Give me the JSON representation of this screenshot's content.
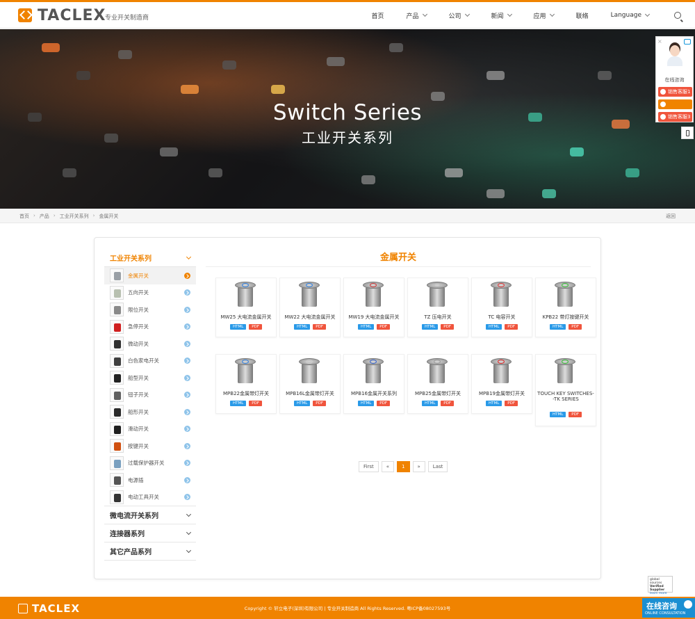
{
  "header": {
    "logo_text": "TACLEX",
    "tagline": "专业开关制造商",
    "nav": [
      {
        "label": "首页",
        "has_menu": false
      },
      {
        "label": "产品",
        "has_menu": true
      },
      {
        "label": "公司",
        "has_menu": true
      },
      {
        "label": "新闻",
        "has_menu": true
      },
      {
        "label": "应用",
        "has_menu": true
      },
      {
        "label": "联络",
        "has_menu": false
      },
      {
        "label": "Language",
        "has_menu": true
      }
    ]
  },
  "banner": {
    "title": "Switch Series",
    "subtitle": "工业开关系列"
  },
  "chat_widget": {
    "label": "在线咨询",
    "buttons": [
      {
        "label": "销售客服1",
        "color": "#f0543c"
      },
      {
        "label": "",
        "color": "#f08300"
      },
      {
        "label": "销售客服3",
        "color": "#f0543c"
      }
    ]
  },
  "breadcrumb": {
    "items": [
      "首页",
      "产品",
      "工业开关系列",
      "金属开关"
    ],
    "sep": "›",
    "back": "返回"
  },
  "sidebar": {
    "active_category": "工业开关系列",
    "items": [
      {
        "label": "金属开关",
        "selected": true,
        "color": "#9aa0a6"
      },
      {
        "label": "五向开关",
        "selected": false,
        "color": "#b8c0b0"
      },
      {
        "label": "限位开关",
        "selected": false,
        "color": "#8a8a8a"
      },
      {
        "label": "急停开关",
        "selected": false,
        "color": "#d02020"
      },
      {
        "label": "微动开关",
        "selected": false,
        "color": "#303030"
      },
      {
        "label": "白色家电开关",
        "selected": false,
        "color": "#404040"
      },
      {
        "label": "船型开关",
        "selected": false,
        "color": "#222222"
      },
      {
        "label": "钮子开关",
        "selected": false,
        "color": "#606060"
      },
      {
        "label": "船形开关",
        "selected": false,
        "color": "#2a2a2a"
      },
      {
        "label": "滑动开关",
        "selected": false,
        "color": "#1f1f1f"
      },
      {
        "label": "按键开关",
        "selected": false,
        "color": "#d05010"
      },
      {
        "label": "过载保护器开关",
        "selected": false,
        "color": "#7aa0c0"
      },
      {
        "label": "电源插",
        "selected": false,
        "color": "#555555"
      },
      {
        "label": "电动工具开关",
        "selected": false,
        "color": "#333333"
      }
    ],
    "other_categories": [
      "微电流开关系列",
      "连接器系列",
      "其它产品系列"
    ]
  },
  "content": {
    "title": "金属开关",
    "tag_html": "HTML",
    "tag_pdf": "PDF",
    "products": [
      {
        "name": "MW25 大电流金属开关",
        "ring": "#2a7de1"
      },
      {
        "name": "MW22 大电流金属开关",
        "ring": "#2a7de1"
      },
      {
        "name": "MW19 大电流金属开关",
        "ring": "#d03030"
      },
      {
        "name": "TZ 压电开关",
        "ring": "#bbbbbb"
      },
      {
        "name": "TC 电容开关",
        "ring": "#e03030"
      },
      {
        "name": "KPB22 带灯按键开关",
        "ring": "#30c030"
      },
      {
        "name": "MPB22金属带灯开关",
        "ring": "#2a7de1"
      },
      {
        "name": "MPB16L金属带灯开关",
        "ring": "#cccccc"
      },
      {
        "name": "MPB16金属开关系列",
        "ring": "#3060d0"
      },
      {
        "name": "MPB25金属带灯开关",
        "ring": "#999999"
      },
      {
        "name": "MPB19金属带灯开关",
        "ring": "#e02020"
      },
      {
        "name": "TOUCH KEY SWITCHES--TK SERIES",
        "ring": "#30c030"
      }
    ]
  },
  "pagination": {
    "first": "First",
    "prev": "«",
    "current": "1",
    "next": "»",
    "last": "Last"
  },
  "badge": {
    "line1": "global sources",
    "line2": "Verified Supplier",
    "line3": "learn more"
  },
  "footer": {
    "logo_text": "TACLEX",
    "copyright": "Copyright © 轩立电子(深圳)有限公司 | 专业开关制造商 All Rights Reserved. 粤ICP备08027593号"
  },
  "consult": {
    "title": "在线咨询",
    "subtitle": "ONLINE CONSULTATION"
  },
  "colors": {
    "accent": "#f08300",
    "html_tag": "#2a9ae8",
    "pdf_tag": "#f0543c"
  }
}
